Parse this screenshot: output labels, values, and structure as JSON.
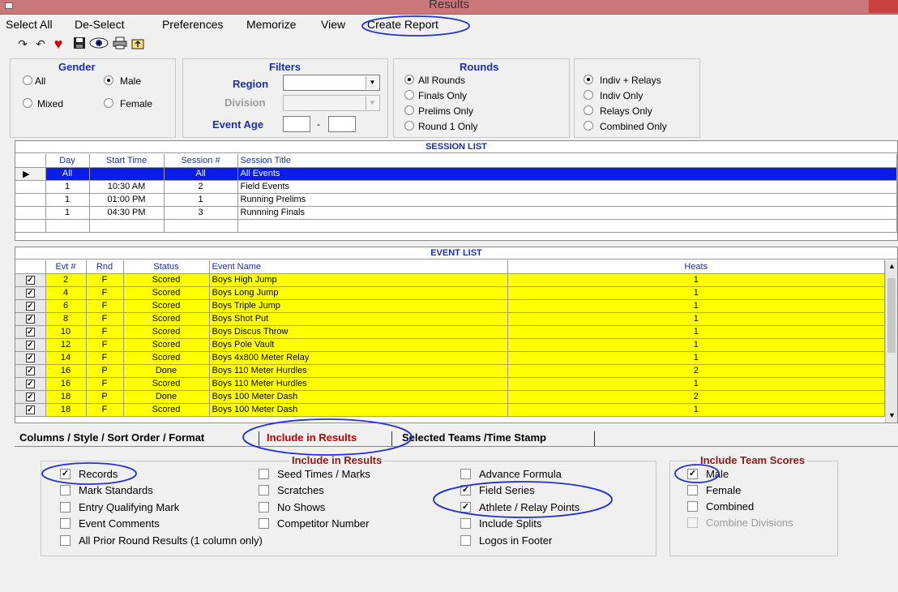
{
  "window": {
    "title": "Results"
  },
  "menu": [
    "Select All",
    "De-Select",
    "Preferences",
    "Memorize",
    "View",
    "Create Report"
  ],
  "toolbar_icons": [
    "redo-icon",
    "undo-icon",
    "heart-icon",
    "save-icon",
    "view-eye-icon",
    "print-icon",
    "export-icon"
  ],
  "gender": {
    "title": "Gender",
    "options": [
      "All",
      "Male",
      "Mixed",
      "Female"
    ],
    "selected": "Male"
  },
  "filters": {
    "title": "Filters",
    "region_label": "Region",
    "division_label": "Division",
    "event_age_label": "Event Age",
    "age_separator": "-"
  },
  "rounds": {
    "title": "Rounds",
    "options": [
      "All Rounds",
      "Finals Only",
      "Prelims Only",
      "Round 1 Only"
    ],
    "selected": "All Rounds"
  },
  "relays": {
    "options": [
      "Indiv + Relays",
      "Indiv Only",
      "Relays Only",
      "Combined Only"
    ],
    "selected": "Indiv + Relays"
  },
  "session_list": {
    "title": "SESSION LIST",
    "columns": [
      "Day",
      "Start Time",
      "Session #",
      "Session Title"
    ],
    "rows": [
      [
        "All",
        "",
        "All",
        "All Events"
      ],
      [
        "1",
        "10:30 AM",
        "2",
        "Field Events"
      ],
      [
        "1",
        "01:00 PM",
        "1",
        "Running Prelims"
      ],
      [
        "1",
        "04:30 PM",
        "3",
        "Runnning Finals"
      ],
      [
        "",
        "",
        "",
        ""
      ]
    ]
  },
  "event_list": {
    "title": "EVENT LIST",
    "columns": [
      "Evt #",
      "Rnd",
      "Status",
      "Event Name",
      "Heats"
    ],
    "rows": [
      [
        "2",
        "F",
        "Scored",
        "Boys High Jump",
        "1"
      ],
      [
        "4",
        "F",
        "Scored",
        "Boys Long Jump",
        "1"
      ],
      [
        "6",
        "F",
        "Scored",
        "Boys Triple Jump",
        "1"
      ],
      [
        "8",
        "F",
        "Scored",
        "Boys Shot Put",
        "1"
      ],
      [
        "10",
        "F",
        "Scored",
        "Boys Discus Throw",
        "1"
      ],
      [
        "12",
        "F",
        "Scored",
        "Boys Pole Vault",
        "1"
      ],
      [
        "14",
        "F",
        "Scored",
        "Boys 4x800 Meter Relay",
        "1"
      ],
      [
        "16",
        "P",
        "Done",
        "Boys 110 Meter Hurdles",
        "2"
      ],
      [
        "16",
        "F",
        "Scored",
        "Boys 110 Meter Hurdles",
        "1"
      ],
      [
        "18",
        "P",
        "Done",
        "Boys 100 Meter Dash",
        "2"
      ],
      [
        "18",
        "F",
        "Scored",
        "Boys 100 Meter Dash",
        "1"
      ]
    ]
  },
  "tabs": [
    "Columns / Style / Sort Order / Format",
    "Include in Results",
    "Selected Teams /Time Stamp"
  ],
  "include_results": {
    "title": "Include in Results",
    "items": [
      {
        "label": "Records",
        "checked": true
      },
      {
        "label": "Mark Standards",
        "checked": false
      },
      {
        "label": "Entry Qualifying Mark",
        "checked": false
      },
      {
        "label": "Event Comments",
        "checked": false
      },
      {
        "label": "All Prior Round Results (1 column only)",
        "checked": false
      },
      {
        "label": "Seed Times / Marks",
        "checked": false
      },
      {
        "label": "Scratches",
        "checked": false
      },
      {
        "label": "No Shows",
        "checked": false
      },
      {
        "label": "Competitor Number",
        "checked": false
      },
      {
        "label": "Advance Formula",
        "checked": false
      },
      {
        "label": "Field Series",
        "checked": true
      },
      {
        "label": "Athlete / Relay Points",
        "checked": true
      },
      {
        "label": "Include Splits",
        "checked": false
      },
      {
        "label": "Logos in Footer",
        "checked": false
      }
    ]
  },
  "team_scores": {
    "title": "Include Team Scores",
    "items": [
      {
        "label": "Male",
        "checked": true
      },
      {
        "label": "Female",
        "checked": false
      },
      {
        "label": "Combined",
        "checked": false
      },
      {
        "label": "Combine Divisions",
        "checked": false,
        "disabled": true
      }
    ]
  },
  "colors": {
    "accent": "#1c2fa8",
    "selection": "#0a1de8",
    "highlight": "#ffff00",
    "section": "#8b1a1a",
    "annotation": "#2233cc"
  }
}
